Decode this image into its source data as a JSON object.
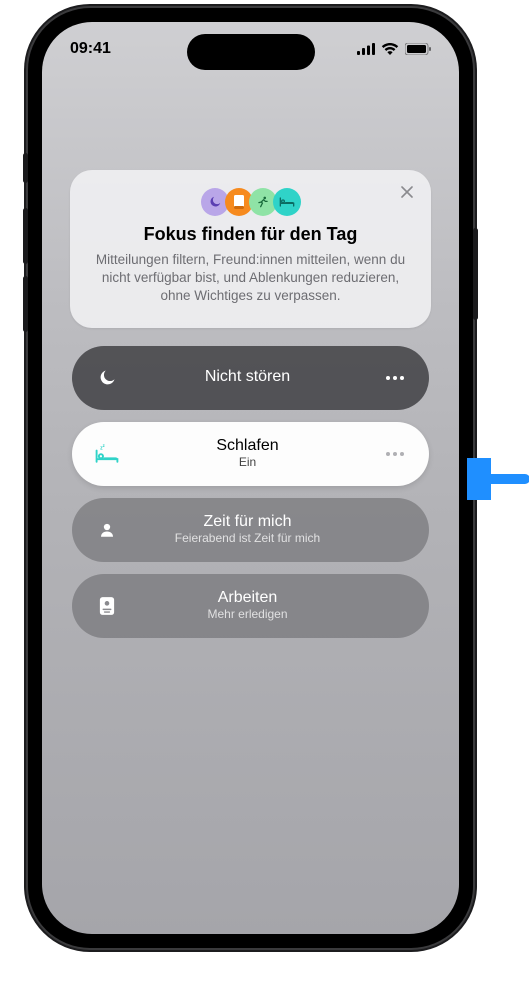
{
  "status": {
    "time": "09:41"
  },
  "promo": {
    "title": "Fokus finden für den Tag",
    "body": "Mitteilungen filtern, Freund:innen mitteilen, wenn du nicht verfügbar bist, und Ablenkungen reduzieren, ohne Wichtiges zu verpassen.",
    "icons": [
      {
        "name": "moon",
        "bg": "#b9a6e8"
      },
      {
        "name": "book",
        "bg": "#f68a1e"
      },
      {
        "name": "runner",
        "bg": "#8fe3a6"
      },
      {
        "name": "bed",
        "bg": "#2fd3c8"
      }
    ]
  },
  "focusModes": [
    {
      "id": "dnd",
      "label": "Nicht stören",
      "sub": "",
      "icon": "moon",
      "style": "dark",
      "hasMore": true
    },
    {
      "id": "sleep",
      "label": "Schlafen",
      "sub": "Ein",
      "icon": "bed",
      "style": "active",
      "hasMore": true
    },
    {
      "id": "personal",
      "label": "Zeit für mich",
      "sub": "Feierabend ist Zeit für mich",
      "icon": "person",
      "style": "dim",
      "hasMore": false
    },
    {
      "id": "work",
      "label": "Arbeiten",
      "sub": "Mehr erledigen",
      "icon": "badge",
      "style": "dim",
      "hasMore": false
    }
  ],
  "calloutColor": "#1f8fff"
}
